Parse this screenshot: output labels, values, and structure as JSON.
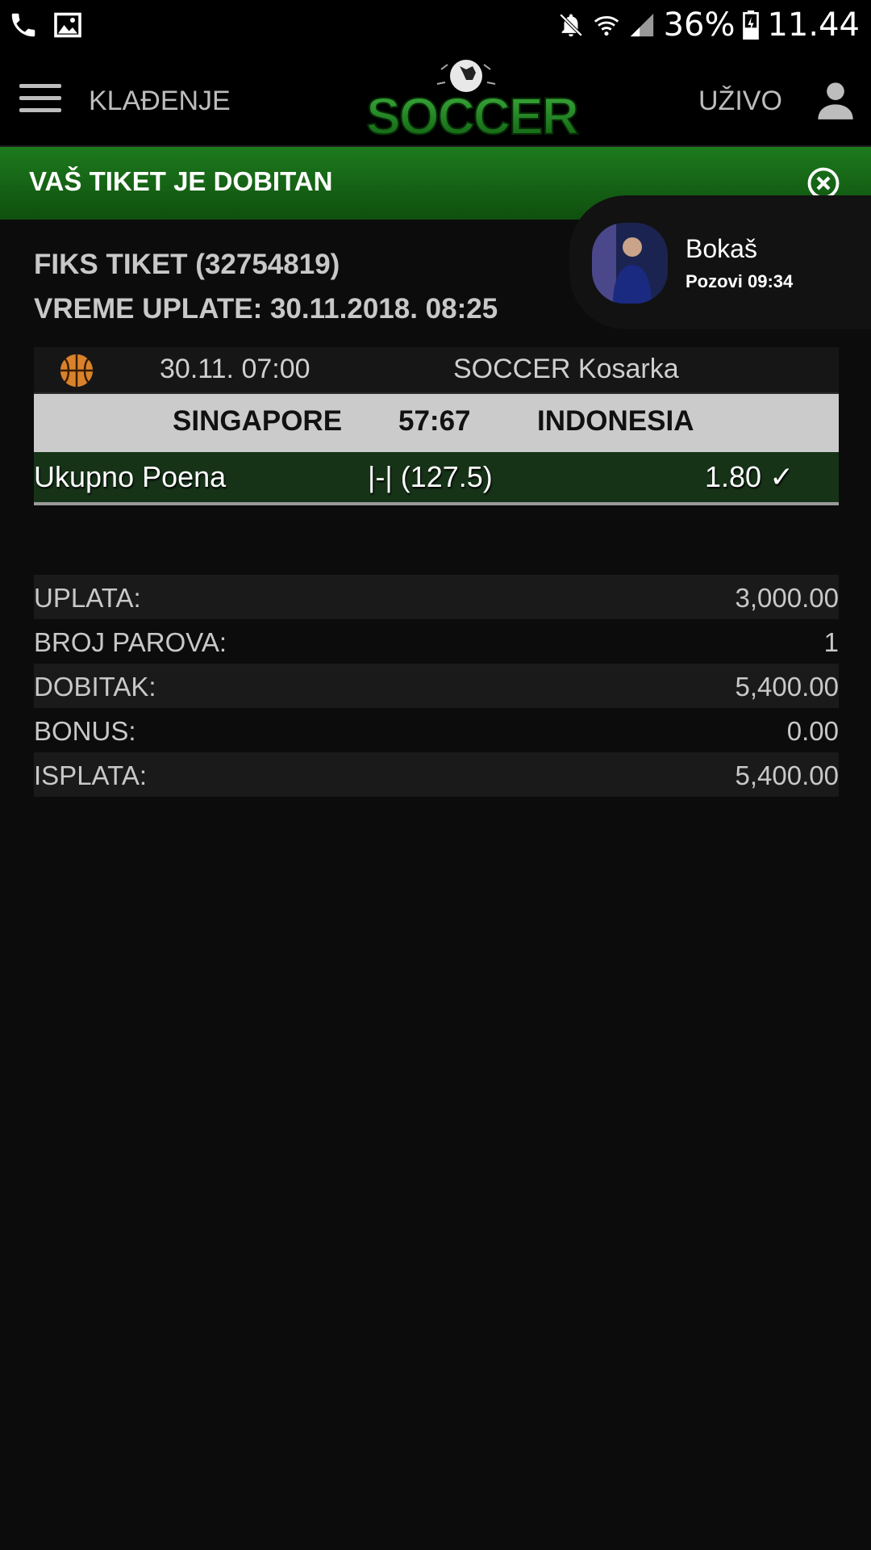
{
  "status": {
    "battery": "36%",
    "time": "11.44"
  },
  "header": {
    "nav_left": "KLAĐENJE",
    "logo_text": "SOCCER",
    "nav_right": "UŽIVO"
  },
  "banner": {
    "title": "VAŠ TIKET JE DOBITAN"
  },
  "ticket": {
    "title": "FIKS TIKET (32754819)",
    "time": "VREME UPLATE: 30.11.2018. 08:25"
  },
  "match": {
    "date": "30.11. 07:00",
    "league": "SOCCER Kosarka",
    "home": "SINGAPORE",
    "score": "57:67",
    "away": "INDONESIA",
    "market": "Ukupno Poena",
    "pick": "|-| (127.5)",
    "odds": "1.80 ✓"
  },
  "summary": [
    {
      "label": "UPLATA:",
      "value": "3,000.00"
    },
    {
      "label": "BROJ PAROVA:",
      "value": "1"
    },
    {
      "label": "DOBITAK:",
      "value": "5,400.00"
    },
    {
      "label": "BONUS:",
      "value": "0.00"
    },
    {
      "label": "ISPLATA:",
      "value": "5,400.00"
    }
  ],
  "call": {
    "name": "Bokaš",
    "subtitle": "Pozovi 09:34"
  },
  "colors": {
    "banner_top": "#1d7a1d",
    "banner_bottom": "#0f4f0f",
    "pick_row": "#163318",
    "teams_row": "#cbcbcb"
  }
}
